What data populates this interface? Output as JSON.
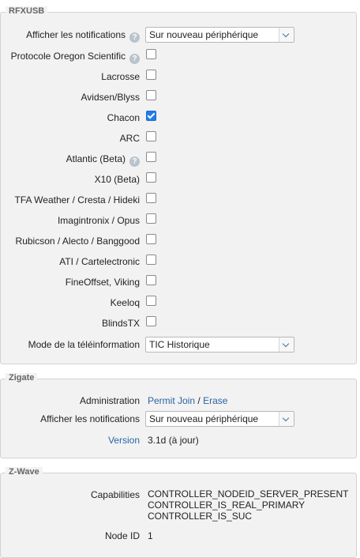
{
  "rfxusb": {
    "legend": "RFXUSB",
    "notifications": {
      "label": "Afficher les notifications",
      "value": "Sur nouveau périphérique"
    },
    "protocols": [
      {
        "label": "Protocole Oregon Scientific",
        "help": true,
        "checked": false
      },
      {
        "label": "Lacrosse",
        "help": false,
        "checked": false
      },
      {
        "label": "Avidsen/Blyss",
        "help": false,
        "checked": false
      },
      {
        "label": "Chacon",
        "help": false,
        "checked": true
      },
      {
        "label": "ARC",
        "help": false,
        "checked": false
      },
      {
        "label": "Atlantic (Beta)",
        "help": true,
        "checked": false
      },
      {
        "label": "X10 (Beta)",
        "help": false,
        "checked": false
      },
      {
        "label": "TFA Weather / Cresta / Hideki",
        "help": false,
        "checked": false
      },
      {
        "label": "Imagintronix / Opus",
        "help": false,
        "checked": false
      },
      {
        "label": "Rubicson / Alecto / Banggood",
        "help": false,
        "checked": false
      },
      {
        "label": "ATI / Cartelectronic",
        "help": false,
        "checked": false
      },
      {
        "label": "FineOffset, Viking",
        "help": false,
        "checked": false
      },
      {
        "label": "Keeloq",
        "help": false,
        "checked": false
      },
      {
        "label": "BlindsTX",
        "help": false,
        "checked": false
      }
    ],
    "teleinfo": {
      "label": "Mode de la téléinformation",
      "value": "TIC Historique"
    }
  },
  "zigate": {
    "legend": "Zigate",
    "administration": {
      "label": "Administration",
      "permit_join": "Permit Join",
      "separator": "/",
      "erase": "Erase"
    },
    "notifications": {
      "label": "Afficher les notifications",
      "value": "Sur nouveau périphérique"
    },
    "version": {
      "label": "Version",
      "value": "3.1d (à jour)"
    }
  },
  "zwave": {
    "legend": "Z-Wave",
    "capabilities": {
      "label": "Capabilities",
      "values": [
        "CONTROLLER_NODEID_SERVER_PRESENT",
        "CONTROLLER_IS_REAL_PRIMARY",
        "CONTROLLER_IS_SUC"
      ]
    },
    "node_id": {
      "label": "Node ID",
      "value": "1"
    }
  },
  "help_glyph": "?"
}
